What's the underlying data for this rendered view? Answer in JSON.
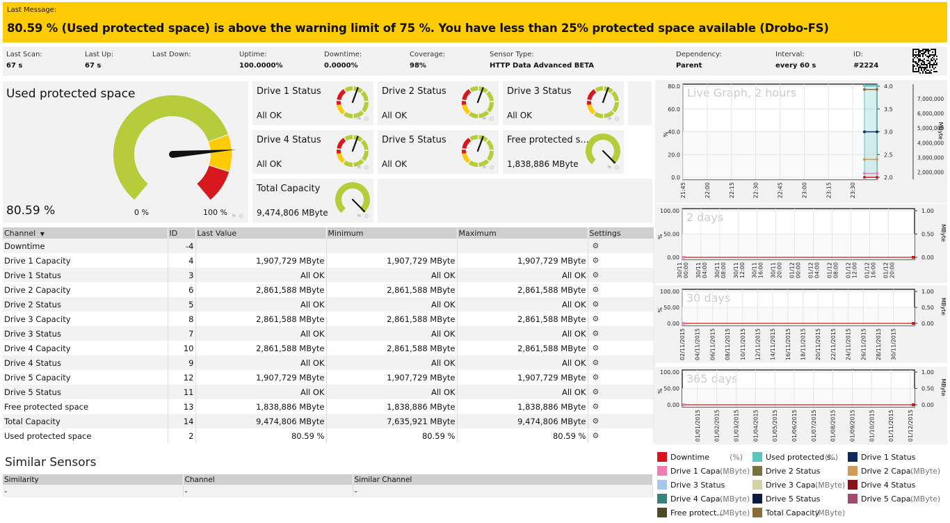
{
  "banner": {
    "label": "Last Message:",
    "message": "80.59 % (Used protected space) is above the warning limit of 75 %. You have less than 25% protected space available (Drobo-FS)",
    "color": "#ffcb05"
  },
  "info": [
    {
      "k": "Last Scan:",
      "v": "67 s"
    },
    {
      "k": "Last Up:",
      "v": "67 s"
    },
    {
      "k": "Last Down:",
      "v": ""
    },
    {
      "k": "Uptime:",
      "v": "100.0000%"
    },
    {
      "k": "Downtime:",
      "v": "0.0000%"
    },
    {
      "k": "Coverage:",
      "v": "98%"
    },
    {
      "k": "Sensor Type:",
      "v": "HTTP Data Advanced BETA"
    },
    {
      "k": "Dependency:",
      "v": "Parent"
    },
    {
      "k": "Interval:",
      "v": "every 60 s"
    },
    {
      "k": "ID:",
      "v": "#2224"
    }
  ],
  "main_gauge": {
    "title": "Used protected space",
    "value": "80.59 %",
    "percent": 80.59,
    "min_label": "0 %",
    "max_label": "100 %"
  },
  "tiles": [
    {
      "title": "Drive 1 Status",
      "value": "All OK",
      "kind": "status"
    },
    {
      "title": "Drive 2 Status",
      "value": "All OK",
      "kind": "status"
    },
    {
      "title": "Drive 3 Status",
      "value": "All OK",
      "kind": "status"
    },
    {
      "title": "Drive 4 Status",
      "value": "All OK",
      "kind": "status"
    },
    {
      "title": "Drive 5 Status",
      "value": "All OK",
      "kind": "status"
    },
    {
      "title": "Free protected s...",
      "value": "1,838,886 MByte",
      "kind": "value"
    },
    {
      "title": "Total Capacity",
      "value": "9,474,806 MByte",
      "kind": "value"
    }
  ],
  "channels": {
    "headers": [
      "Channel",
      "ID",
      "Last Value",
      "Minimum",
      "Maximum",
      "Settings"
    ],
    "sort_icon": "sort-down-icon",
    "rows": [
      [
        "Downtime",
        "-4",
        "",
        "",
        ""
      ],
      [
        "Drive 1 Capacity",
        "4",
        "1,907,729 MByte",
        "1,907,729 MByte",
        "1,907,729 MByte"
      ],
      [
        "Drive 1 Status",
        "3",
        "All OK",
        "All OK",
        "All OK"
      ],
      [
        "Drive 2 Capacity",
        "6",
        "2,861,588 MByte",
        "2,861,588 MByte",
        "2,861,588 MByte"
      ],
      [
        "Drive 2 Status",
        "5",
        "All OK",
        "All OK",
        "All OK"
      ],
      [
        "Drive 3 Capacity",
        "8",
        "2,861,588 MByte",
        "2,861,588 MByte",
        "2,861,588 MByte"
      ],
      [
        "Drive 3 Status",
        "7",
        "All OK",
        "All OK",
        "All OK"
      ],
      [
        "Drive 4 Capacity",
        "10",
        "2,861,588 MByte",
        "2,861,588 MByte",
        "2,861,588 MByte"
      ],
      [
        "Drive 4 Status",
        "9",
        "All OK",
        "All OK",
        "All OK"
      ],
      [
        "Drive 5 Capacity",
        "12",
        "1,907,729 MByte",
        "1,907,729 MByte",
        "1,907,729 MByte"
      ],
      [
        "Drive 5 Status",
        "11",
        "All OK",
        "All OK",
        "All OK"
      ],
      [
        "Free protected space",
        "13",
        "1,838,886 MByte",
        "1,838,886 MByte",
        "1,838,886 MByte"
      ],
      [
        "Total Capacity",
        "14",
        "9,474,806 MByte",
        "7,635,921 MByte",
        "9,474,806 MByte"
      ],
      [
        "Used protected space",
        "2",
        "80.59 %",
        "80.59 %",
        "80.59 %"
      ]
    ],
    "settings_icon": "gear-icon"
  },
  "similar": {
    "title": "Similar Sensors",
    "headers": [
      "Similarity",
      "Channel",
      "Similar Channel"
    ],
    "rows": [
      [
        "-",
        "-",
        "-"
      ]
    ]
  },
  "chart_data": [
    {
      "type": "line",
      "title": "Live Graph, 2 hours",
      "ylabel": "%",
      "y2label": "MByte",
      "x": [
        "21:45",
        "22:00",
        "22:15",
        "22:30",
        "22:45",
        "23:00",
        "23:15",
        "23:30"
      ],
      "y_ticks": [
        "0.0",
        "20.0",
        "40.0",
        "60.0",
        "80.0"
      ],
      "ylim": [
        0,
        80
      ],
      "y2_ticks": [
        "2.0",
        "2.5",
        "3.0",
        "3.5",
        "4.0"
      ],
      "y2lim": [
        2,
        4
      ],
      "y3_ticks": [
        "2,000,000",
        "3,000,000",
        "4,000,000",
        "5,000,000",
        "6,000,000",
        "7,000,000"
      ],
      "y3lim": [
        1500000,
        8000000
      ],
      "grid": true,
      "series": [
        {
          "name": "Used protected space",
          "axis": "y",
          "value": 80.59,
          "color": "#5bc4bf"
        },
        {
          "name": "Total Capacity",
          "axis": "y3",
          "value": 7635921,
          "color": "#8c6a3a"
        },
        {
          "name": "Drive 1 Status",
          "axis": "y2",
          "value": 3.0,
          "color": "#0f2a5c"
        },
        {
          "name": "Drive 2 Capacity",
          "axis": "y3",
          "value": 2861588,
          "color": "#d29b55"
        },
        {
          "name": "Drive 1 Capacity",
          "axis": "y3",
          "value": 1907729,
          "color": "#f27bb5"
        },
        {
          "name": "Downtime",
          "axis": "y",
          "value": 0,
          "color": "#d7141e"
        }
      ]
    },
    {
      "type": "line",
      "title": "2 days",
      "ylabel": "%",
      "y2label": "MByte",
      "x": [
        "30/11 00:00",
        "30/11 04:00",
        "30/11 08:00",
        "30/11 12:00",
        "30/11 16:00",
        "30/11 20:00",
        "01/12 00:00",
        "01/12 04:00",
        "01/12 08:00",
        "01/12 12:00",
        "01/12 16:00",
        "01/12 20:00"
      ],
      "y_ticks": [
        "0.00",
        "50.00",
        "100.00"
      ],
      "y2_ticks": [
        "0.00",
        "0.50",
        "1.00"
      ],
      "ylim": [
        0,
        100
      ],
      "grid": true,
      "series": [
        {
          "name": "Downtime",
          "value": 0,
          "color": "#d7141e"
        }
      ]
    },
    {
      "type": "line",
      "title": "30 days",
      "ylabel": "%",
      "y2label": "MByte",
      "x": [
        "02/11/2015",
        "04/11/2015",
        "06/11/2015",
        "08/11/2015",
        "10/11/2015",
        "12/11/2015",
        "14/11/2015",
        "16/11/2015",
        "18/11/2015",
        "20/11/2015",
        "22/11/2015",
        "24/11/2015",
        "26/11/2015",
        "28/11/2015",
        "30/11/2015"
      ],
      "y_ticks": [
        "0.00",
        "50.00",
        "100.00"
      ],
      "y2_ticks": [
        "0.00",
        "0.50",
        "1.00"
      ],
      "ylim": [
        0,
        100
      ],
      "grid": true,
      "series": [
        {
          "name": "Downtime",
          "value": 0,
          "color": "#d7141e"
        }
      ]
    },
    {
      "type": "line",
      "title": "365 days",
      "ylabel": "%",
      "y2label": "MByte",
      "x": [
        "01/01/2015",
        "01/02/2015",
        "01/03/2015",
        "01/04/2015",
        "01/05/2015",
        "01/06/2015",
        "01/07/2015",
        "01/08/2015",
        "01/09/2015",
        "01/10/2015",
        "01/11/2015",
        "01/12/2015"
      ],
      "y_ticks": [
        "0.00",
        "50.00",
        "100.00"
      ],
      "y2_ticks": [
        "0.00",
        "0.50",
        "1.00"
      ],
      "ylim": [
        0,
        100
      ],
      "grid": true,
      "series": [
        {
          "name": "Downtime",
          "value": 0,
          "color": "#d7141e"
        }
      ]
    }
  ],
  "legend": [
    {
      "name": "Downtime",
      "unit": "(%)",
      "color": "#d7141e"
    },
    {
      "name": "Used protected s...",
      "unit": "(%)",
      "color": "#5bc4bf"
    },
    {
      "name": "Drive 1 Status",
      "unit": "",
      "color": "#0f2a5c"
    },
    {
      "name": "Drive 1 Capa...",
      "unit": "(MByte)",
      "color": "#f27bb5"
    },
    {
      "name": "Drive 2 Status",
      "unit": "",
      "color": "#78733c"
    },
    {
      "name": "Drive 2 Capa...",
      "unit": "(MByte)",
      "color": "#d29b55"
    },
    {
      "name": "Drive 3 Status",
      "unit": "",
      "color": "#a7c8ea"
    },
    {
      "name": "Drive 3 Capa...",
      "unit": "(MByte)",
      "color": "#d6d0a8"
    },
    {
      "name": "Drive 4 Status",
      "unit": "",
      "color": "#8b1218"
    },
    {
      "name": "Drive 4 Capa...",
      "unit": "(MByte)",
      "color": "#3a817c"
    },
    {
      "name": "Drive 5 Status",
      "unit": "",
      "color": "#0c1a40"
    },
    {
      "name": "Drive 5 Capa...",
      "unit": "(MByte)",
      "color": "#a04c72"
    },
    {
      "name": "Free protect...",
      "unit": "(MByte)",
      "color": "#4f4a26"
    },
    {
      "name": "Total Capacity",
      "unit": "(MByte)",
      "color": "#8c6a3a"
    }
  ]
}
